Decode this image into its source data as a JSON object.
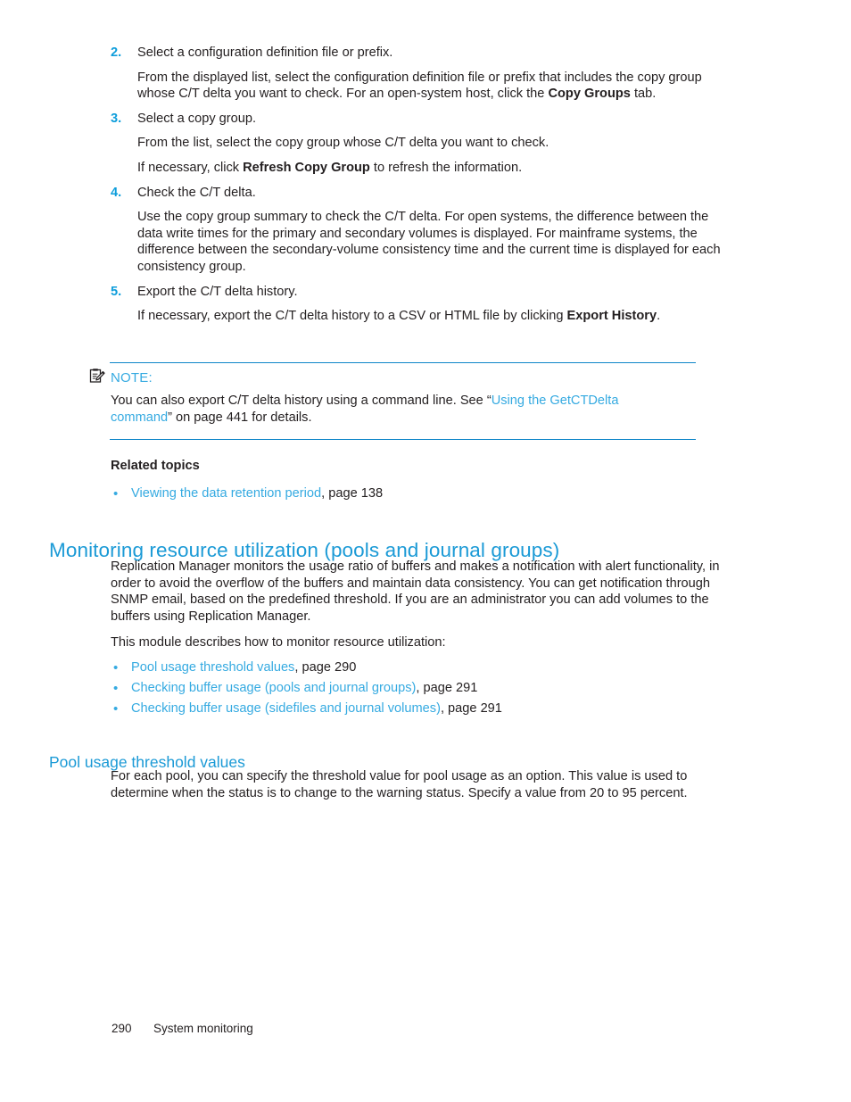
{
  "colors": {
    "heading_blue": "#1b9ad6",
    "link_blue": "#35aae1",
    "rule_blue": "#0d85c8",
    "step_number_blue": "#0d9ddb",
    "body_text": "#231f20"
  },
  "steps": [
    {
      "number": "2.",
      "title": "Select a configuration definition file or prefix.",
      "paragraphs": [
        {
          "segments": [
            {
              "text": "From the displayed list, select the configuration definition file or prefix that includes the copy group whose C/T delta you want to check. For an open-system host, click the ",
              "style": "normal"
            },
            {
              "text": "Copy Groups",
              "style": "bold"
            },
            {
              "text": " tab.",
              "style": "normal"
            }
          ]
        }
      ]
    },
    {
      "number": "3.",
      "title": "Select a copy group.",
      "paragraphs": [
        {
          "segments": [
            {
              "text": "From the list, select the copy group whose C/T delta you want to check.",
              "style": "normal"
            }
          ]
        },
        {
          "segments": [
            {
              "text": "If necessary, click ",
              "style": "normal"
            },
            {
              "text": "Refresh Copy Group",
              "style": "bold"
            },
            {
              "text": " to refresh the information.",
              "style": "normal"
            }
          ]
        }
      ]
    },
    {
      "number": "4.",
      "title": "Check the C/T delta.",
      "paragraphs": [
        {
          "segments": [
            {
              "text": "Use the copy group summary to check the C/T delta. For open systems, the difference between the data write times for the primary and secondary volumes is displayed. For mainframe systems, the difference between the secondary-volume consistency time and the current time is displayed for each consistency group.",
              "style": "normal"
            }
          ]
        }
      ]
    },
    {
      "number": "5.",
      "title": "Export the C/T delta history.",
      "paragraphs": [
        {
          "segments": [
            {
              "text": "If necessary, export the C/T delta history to a CSV or HTML file by clicking ",
              "style": "normal"
            },
            {
              "text": "Export History",
              "style": "bold"
            },
            {
              "text": ".",
              "style": "normal"
            }
          ]
        }
      ]
    }
  ],
  "note": {
    "icon": "note-clipboard-pencil-icon",
    "title": "NOTE:",
    "segments": [
      {
        "text": "You can also export C/T delta history using a command line. See “",
        "style": "normal"
      },
      {
        "text": "Using the GetCTDelta command",
        "style": "link"
      },
      {
        "text": "” on page 441 for details.",
        "style": "normal"
      }
    ]
  },
  "related_topics": {
    "heading": "Related topics",
    "items": [
      {
        "link": "Viewing the data retention period",
        "suffix": ", page 138"
      }
    ]
  },
  "section": {
    "heading": "Monitoring resource utilization (pools and journal groups)",
    "intro": "Replication Manager monitors the usage ratio of buffers and makes a notification with alert functionality, in order to avoid the overflow of the buffers and maintain data consistency. You can get notification through SNMP email, based on the predefined threshold. If you are an administrator you can add volumes to the buffers using Replication Manager.",
    "module_intro": "This module describes how to monitor resource utilization:",
    "module_items": [
      {
        "link": "Pool usage threshold values",
        "suffix": ", page 290"
      },
      {
        "link": "Checking buffer usage (pools and journal groups)",
        "suffix": ", page 291"
      },
      {
        "link": "Checking buffer usage (sidefiles and journal volumes)",
        "suffix": ", page 291"
      }
    ]
  },
  "subsection": {
    "heading": "Pool usage threshold values",
    "paragraph": "For each pool, you can specify the threshold value for pool usage as an option. This value is used to determine when the status is to change to the warning status. Specify a value from 20 to 95 percent."
  },
  "footer": {
    "page_number": "290",
    "chapter": "System monitoring"
  }
}
